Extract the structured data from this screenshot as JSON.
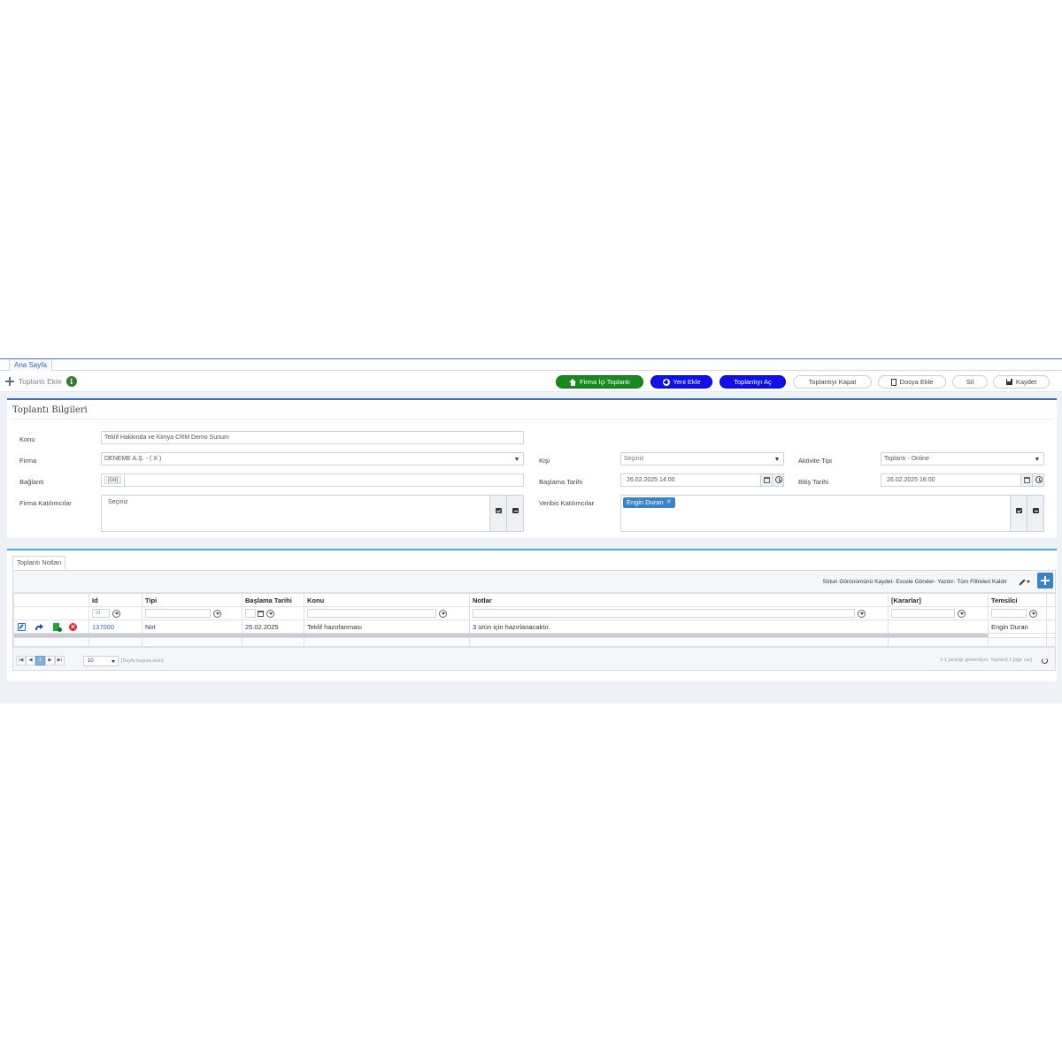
{
  "tabs": {
    "home": "Ana Sayfa"
  },
  "toolbar": {
    "title": "Toplantı Ekle",
    "buttons": {
      "firma_ici": "Firma İçi Toplantı",
      "yeni_ekle": "Yeni Ekle",
      "toplantiyi_ac": "Toplantıyı Aç",
      "toplantiyi_kapat": "Toplantıyı Kapat",
      "dosya_ekle": "Dosya Ekle",
      "sil": "Sil",
      "kaydet": "Kaydet"
    }
  },
  "form": {
    "title": "Toplantı Bilgileri",
    "konu_label": "Konu",
    "konu_value": "Teklif Hakkında ve Kimya CRM Demo Sunum",
    "firma_label": "Firma",
    "firma_value": "DENEME A.Ş. - ( X )",
    "baglanti_label": "Bağlantı",
    "baglanti_git": "[Git]",
    "firma_katilimcilar_label": "Firma Katılımcılar",
    "firma_katilimcilar_value": "Seçiniz",
    "kisi_label": "Kişi",
    "kisi_value": "Seçiniz",
    "baslama_label": "Başlama Tarihi",
    "baslama_value": "26.02.2025 14:00",
    "veribis_label": "Veribis Katılımcılar",
    "veribis_tag": "Engin Duran",
    "aktivite_label": "Aktivite Tipi",
    "aktivite_value": "Toplantı - Online",
    "bitis_label": "Bitiş Tarihi",
    "bitis_value": "26.02.2025 16:00"
  },
  "notes": {
    "tab_label": "Toplantı Notları",
    "grid_links": "Sütun Görünümünü Kaydet- Excele Gönder- Yazdır- Tüm Filtreleri Kaldır",
    "columns": [
      "Id",
      "Tipi",
      "Başlama Tarihi",
      "Konu",
      "Notlar",
      "[Kararlar]",
      "Temsilci"
    ],
    "id_filter_placeholder": "Id",
    "rows": [
      {
        "id": "137000",
        "tipi": "Not",
        "baslama": "25.02.2025",
        "konu": "Teklif hazırlanması",
        "notlar": "3 ürün için hazırlanacaktır.",
        "kararlar": "",
        "temsilci": "Engin Duran"
      }
    ],
    "pager": {
      "first": "|◀",
      "prev": "◀",
      "current": "1",
      "next": "▶",
      "last": "▶|",
      "page_size": "10",
      "per_page_text": "[Sayfa başına ürün]",
      "info": "1-1 [aralığı gösteriliyor. Toplam] 1 [öğe var]"
    }
  }
}
